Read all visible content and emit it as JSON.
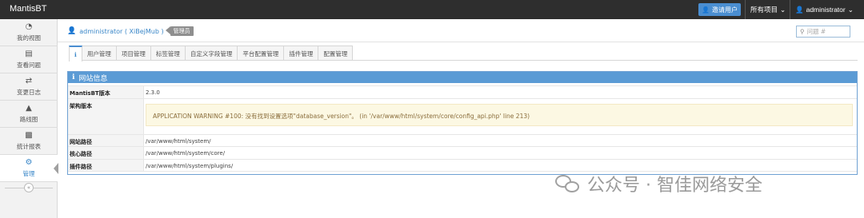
{
  "app": {
    "brand": "MantisBT"
  },
  "navbar": {
    "invite_label": "邀请用户",
    "projects_label": "所有项目",
    "user_label": "administrator"
  },
  "sidebar": {
    "items": [
      {
        "label": "我的视图",
        "icon": "dashboard-icon"
      },
      {
        "label": "查看问题",
        "icon": "list-icon"
      },
      {
        "label": "变更日志",
        "icon": "retweet-icon"
      },
      {
        "label": "路线图",
        "icon": "road-icon"
      },
      {
        "label": "统计报表",
        "icon": "bar-chart-icon"
      },
      {
        "label": "管理",
        "icon": "gears-icon",
        "active": true
      }
    ]
  },
  "breadcrumb": {
    "user": "administrator ( XiBejMub )",
    "role_badge": "管理员"
  },
  "search": {
    "placeholder": "问题 #"
  },
  "tabs": [
    {
      "label": "ℹ",
      "active": true
    },
    {
      "label": "用户管理"
    },
    {
      "label": "项目管理"
    },
    {
      "label": "标签管理"
    },
    {
      "label": "自定义字段管理"
    },
    {
      "label": "平台配置管理"
    },
    {
      "label": "插件管理"
    },
    {
      "label": "配置管理"
    }
  ],
  "panel": {
    "title": "网站信息",
    "rows": [
      {
        "key": "MantisBT版本",
        "value": "2.3.0"
      },
      {
        "key": "架构版本",
        "value": "APPLICATION WARNING #100: 没有找到设置选项\"database_version\"。 (in '/var/www/html/system/core/config_api.php' line 213)"
      },
      {
        "key": "网站路径",
        "value": "/var/www/html/system/"
      },
      {
        "key": "核心路径",
        "value": "/var/www/html/system/core/"
      },
      {
        "key": "插件路径",
        "value": "/var/www/html/system/plugins/"
      }
    ]
  },
  "watermark": {
    "text": "公众号 · 智佳网络安全"
  },
  "colors": {
    "navbar": "#2e2e2e",
    "accent": "#5b9bd5",
    "warning_bg": "#fcf8e3",
    "warning_text": "#8a6d3b"
  }
}
